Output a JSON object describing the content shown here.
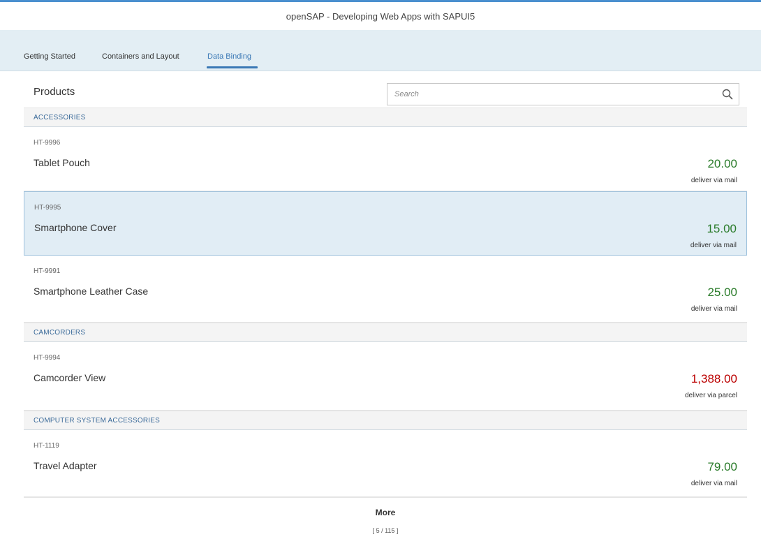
{
  "app": {
    "title": "openSAP - Developing Web Apps with SAPUI5"
  },
  "tabs": [
    {
      "label": "Getting Started",
      "selected": false
    },
    {
      "label": "Containers and Layout",
      "selected": false
    },
    {
      "label": "Data Binding",
      "selected": true
    }
  ],
  "list": {
    "title": "Products",
    "search_placeholder": "Search",
    "groups": [
      {
        "name": "ACCESSORIES",
        "items": [
          {
            "id": "HT-9996",
            "name": "Tablet Pouch",
            "price": "20.00",
            "delivery": "deliver via mail",
            "selected": false,
            "price_state": "success"
          },
          {
            "id": "HT-9995",
            "name": "Smartphone Cover",
            "price": "15.00",
            "delivery": "deliver via mail",
            "selected": true,
            "price_state": "success"
          },
          {
            "id": "HT-9991",
            "name": "Smartphone Leather Case",
            "price": "25.00",
            "delivery": "deliver via mail",
            "selected": false,
            "price_state": "success"
          }
        ]
      },
      {
        "name": "CAMCORDERS",
        "items": [
          {
            "id": "HT-9994",
            "name": "Camcorder View",
            "price": "1,388.00",
            "delivery": "deliver via parcel",
            "selected": false,
            "price_state": "error"
          }
        ]
      },
      {
        "name": "COMPUTER SYSTEM ACCESSORIES",
        "items": [
          {
            "id": "HT-1119",
            "name": "Travel Adapter",
            "price": "79.00",
            "delivery": "deliver via mail",
            "selected": false,
            "price_state": "success"
          }
        ]
      }
    ],
    "more_label": "More",
    "count": "[ 5 / 115 ]"
  },
  "colors": {
    "accent": "#3a78b5",
    "price_success": "#2b7c2b",
    "price_error": "#bb0000",
    "tabbar_bg": "#e3eef4",
    "selected_row_bg": "#e1edf5"
  },
  "icons": {
    "search": "search-icon"
  }
}
